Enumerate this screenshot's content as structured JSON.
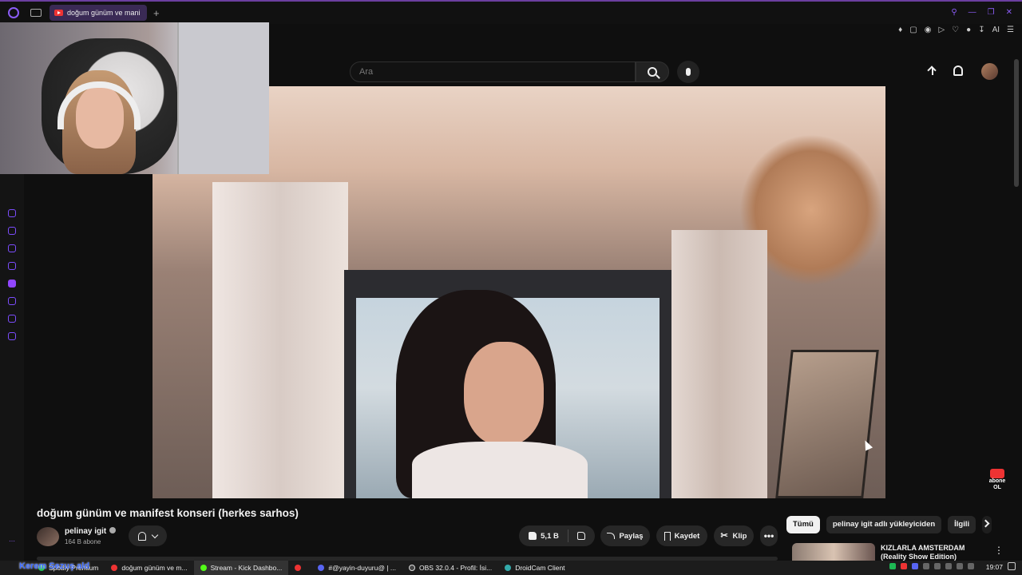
{
  "browser": {
    "tab_title": "doğum günüm ve mani",
    "new_tab": "+",
    "ai_label": "AI"
  },
  "youtube": {
    "search_placeholder": "Ara",
    "video_title": "doğum günüm ve manifest konseri (herkes sarhos)",
    "channel_name": "pelinay igit",
    "subscriber_count": "164 B abone",
    "like_count": "5,1 B",
    "share_label": "Paylaş",
    "save_label": "Kaydet",
    "clip_label": "Klip",
    "more_label": "•••",
    "subscribe_overlay": "abone OL",
    "chips": [
      "Tümü",
      "pelinay igit adlı yükleyiciden",
      "İlgili"
    ],
    "recommended_title": "KIZLARLA AMSTERDAM (Reality Show Edition)"
  },
  "taskbar": {
    "items": [
      {
        "label": "Spotify Premium",
        "color": "#1db954"
      },
      {
        "label": "doğum günüm ve m...",
        "color": "#e33"
      },
      {
        "label": "Stream - Kick Dashbo...",
        "color": "#53fc18"
      },
      {
        "label": "",
        "color": "#e33"
      },
      {
        "label": "#@yayin-duyuru@ | ...",
        "color": "#5865f2"
      },
      {
        "label": "OBS 32.0.4 - Profil: İsi...",
        "color": "#444"
      },
      {
        "label": "DroidCam Client",
        "color": "#3aa"
      }
    ],
    "clock": "19:07"
  },
  "stream_overlay_name": "Kerem Sezuş ald"
}
